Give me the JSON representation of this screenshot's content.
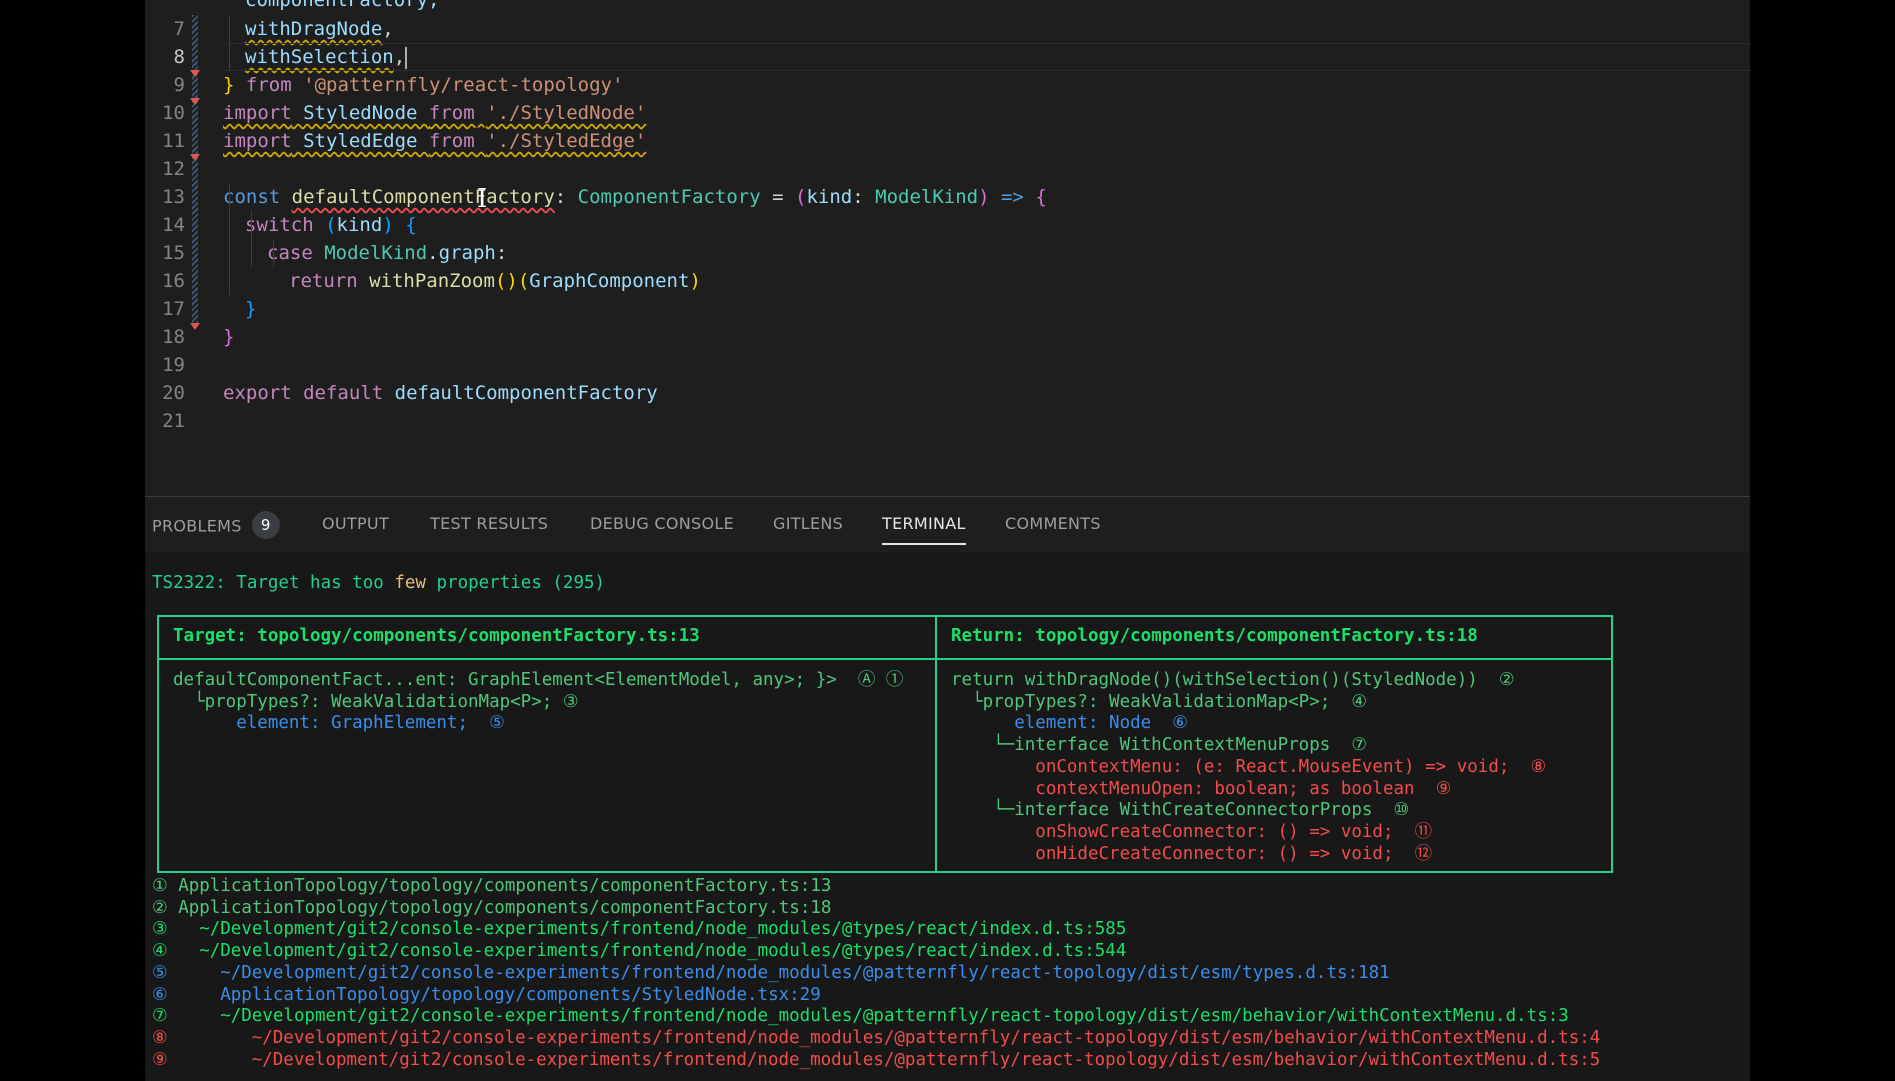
{
  "editor": {
    "top_partial": "componentFactory,",
    "lines": [
      {
        "n": "7",
        "parts": [
          {
            "t": "withDragNode",
            "c": "var squig-warn"
          },
          {
            "t": ",",
            "c": "plain"
          }
        ]
      },
      {
        "n": "8",
        "parts": [
          {
            "t": "withSelection",
            "c": "var squig-warn"
          },
          {
            "t": ",",
            "c": "plain"
          }
        ]
      },
      {
        "n": "9",
        "parts": [
          {
            "t": "}",
            "c": "punc-gold"
          },
          {
            "t": " ",
            "c": "plain"
          },
          {
            "t": "from",
            "c": "kw2"
          },
          {
            "t": " ",
            "c": "plain"
          },
          {
            "t": "'@patternfly/react-topology'",
            "c": "str"
          }
        ]
      },
      {
        "n": "10",
        "parts": [
          {
            "t": "import",
            "c": "kw2 squig-warn"
          },
          {
            "t": " StyledNode ",
            "c": "var squig-warn"
          },
          {
            "t": "from",
            "c": "kw2 squig-warn"
          },
          {
            "t": " ",
            "c": "plain squig-warn"
          },
          {
            "t": "'./StyledNode'",
            "c": "str squig-warn"
          }
        ]
      },
      {
        "n": "11",
        "parts": [
          {
            "t": "import",
            "c": "kw2 squig-warn"
          },
          {
            "t": " StyledEdge ",
            "c": "var squig-warn"
          },
          {
            "t": "from",
            "c": "kw2 squig-warn"
          },
          {
            "t": " ",
            "c": "plain squig-warn"
          },
          {
            "t": "'./StyledEdge'",
            "c": "str squig-warn"
          }
        ]
      },
      {
        "n": "12",
        "parts": []
      },
      {
        "n": "13",
        "parts": [
          {
            "t": "const",
            "c": "kw"
          },
          {
            "t": " ",
            "c": "plain"
          },
          {
            "t": "defaultComponentFactory",
            "c": "fn squig-err"
          },
          {
            "t": ": ",
            "c": "plain"
          },
          {
            "t": "ComponentFactory",
            "c": "ty"
          },
          {
            "t": " = ",
            "c": "plain"
          },
          {
            "t": "(",
            "c": "punc-pink"
          },
          {
            "t": "kind",
            "c": "var"
          },
          {
            "t": ": ",
            "c": "plain"
          },
          {
            "t": "ModelKind",
            "c": "ty"
          },
          {
            "t": ")",
            "c": "punc-pink"
          },
          {
            "t": " ",
            "c": "plain"
          },
          {
            "t": "=>",
            "c": "kw"
          },
          {
            "t": " ",
            "c": "plain"
          },
          {
            "t": "{",
            "c": "punc-pink"
          }
        ]
      },
      {
        "n": "14",
        "parts": [
          {
            "t": "switch",
            "c": "kw2"
          },
          {
            "t": " ",
            "c": "plain"
          },
          {
            "t": "(",
            "c": "punc-blue"
          },
          {
            "t": "kind",
            "c": "var"
          },
          {
            "t": ")",
            "c": "punc-blue"
          },
          {
            "t": " ",
            "c": "plain"
          },
          {
            "t": "{",
            "c": "punc-blue"
          }
        ]
      },
      {
        "n": "15",
        "parts": [
          {
            "t": "case",
            "c": "kw2"
          },
          {
            "t": " ",
            "c": "plain"
          },
          {
            "t": "ModelKind",
            "c": "ty"
          },
          {
            "t": ".",
            "c": "plain"
          },
          {
            "t": "graph",
            "c": "var"
          },
          {
            "t": ":",
            "c": "plain"
          }
        ]
      },
      {
        "n": "16",
        "parts": [
          {
            "t": "return",
            "c": "kw2"
          },
          {
            "t": " ",
            "c": "plain"
          },
          {
            "t": "withPanZoom",
            "c": "fn"
          },
          {
            "t": "()",
            "c": "punc-gold"
          },
          {
            "t": "(",
            "c": "punc-gold"
          },
          {
            "t": "GraphComponent",
            "c": "var"
          },
          {
            "t": ")",
            "c": "punc-gold"
          }
        ]
      },
      {
        "n": "17",
        "parts": [
          {
            "t": "}",
            "c": "punc-blue"
          }
        ]
      },
      {
        "n": "18",
        "parts": [
          {
            "t": "}",
            "c": "punc-pink"
          }
        ]
      },
      {
        "n": "19",
        "parts": []
      },
      {
        "n": "20",
        "parts": [
          {
            "t": "export",
            "c": "kw2"
          },
          {
            "t": " ",
            "c": "plain"
          },
          {
            "t": "default",
            "c": "kw2"
          },
          {
            "t": " ",
            "c": "plain"
          },
          {
            "t": "defaultComponentFactory",
            "c": "var"
          }
        ]
      },
      {
        "n": "21",
        "parts": []
      }
    ],
    "active_line": "8"
  },
  "panel": {
    "tabs": [
      {
        "label": "PROBLEMS",
        "badge": "9",
        "active": false
      },
      {
        "label": "OUTPUT",
        "active": false
      },
      {
        "label": "TEST RESULTS",
        "active": false
      },
      {
        "label": "DEBUG CONSOLE",
        "active": false
      },
      {
        "label": "GITLENS",
        "active": false
      },
      {
        "label": "TERMINAL",
        "active": true
      },
      {
        "label": "COMMENTS",
        "active": false
      }
    ]
  },
  "terminal": {
    "error_title": "TS2322: Target has too",
    "error_few": "few",
    "error_rest": "properties (295)",
    "target_header": "Target: topology/components/componentFactory.ts:13",
    "return_header": "Return: topology/components/componentFactory.ts:18",
    "target_lines": [
      "defaultComponentFact...ent: GraphElement<ElementModel, any>; }>  Ⓐ ①",
      "  └propTypes?: WeakValidationMap<P>; ③",
      "      element: GraphElement;  ⑤"
    ],
    "return_lines": [
      "return withDragNode()(withSelection()(StyledNode))  ②",
      "  └propTypes?: WeakValidationMap<P>;  ④",
      "      element: Node  ⑥",
      "    └─interface WithContextMenuProps  ⑦",
      "        onContextMenu: (e: React.MouseEvent) => void;  ⑧",
      "        contextMenuOpen: boolean; as boolean  ⑨",
      "    └─interface WithCreateConnectorProps  ⑩",
      "        onShowCreateConnector: () => void;  ⑪",
      "        onHideCreateConnector: () => void;  ⑫"
    ],
    "footnotes": [
      {
        "num": "①",
        "path": "ApplicationTopology/topology/components/componentFactory.ts:13",
        "indent": 1
      },
      {
        "num": "②",
        "path": "ApplicationTopology/topology/components/componentFactory.ts:18",
        "indent": 1
      },
      {
        "num": "③",
        "path": "~/Development/git2/console-experiments/frontend/node_modules/@types/react/index.d.ts:585",
        "indent": 3
      },
      {
        "num": "④",
        "path": "~/Development/git2/console-experiments/frontend/node_modules/@types/react/index.d.ts:544",
        "indent": 3
      },
      {
        "num": "⑤",
        "path": "~/Development/git2/console-experiments/frontend/node_modules/@patternfly/react-topology/dist/esm/types.d.ts:181",
        "indent": 5
      },
      {
        "num": "⑥",
        "path": "ApplicationTopology/topology/components/StyledNode.tsx:29",
        "indent": 5
      },
      {
        "num": "⑦",
        "path": "~/Development/git2/console-experiments/frontend/node_modules/@patternfly/react-topology/dist/esm/behavior/withContextMenu.d.ts:3",
        "indent": 5
      },
      {
        "num": "⑧",
        "path": "~/Development/git2/console-experiments/frontend/node_modules/@patternfly/react-topology/dist/esm/behavior/withContextMenu.d.ts:4",
        "indent": 8
      },
      {
        "num": "⑨",
        "path": "~/Development/git2/console-experiments/frontend/node_modules/@patternfly/react-topology/dist/esm/behavior/withContextMenu.d.ts:5",
        "indent": 8
      }
    ]
  },
  "colors": {
    "editor_bg": "#1e1e1e",
    "terminal_bg": "#181818",
    "box_border": "#23d18b"
  }
}
